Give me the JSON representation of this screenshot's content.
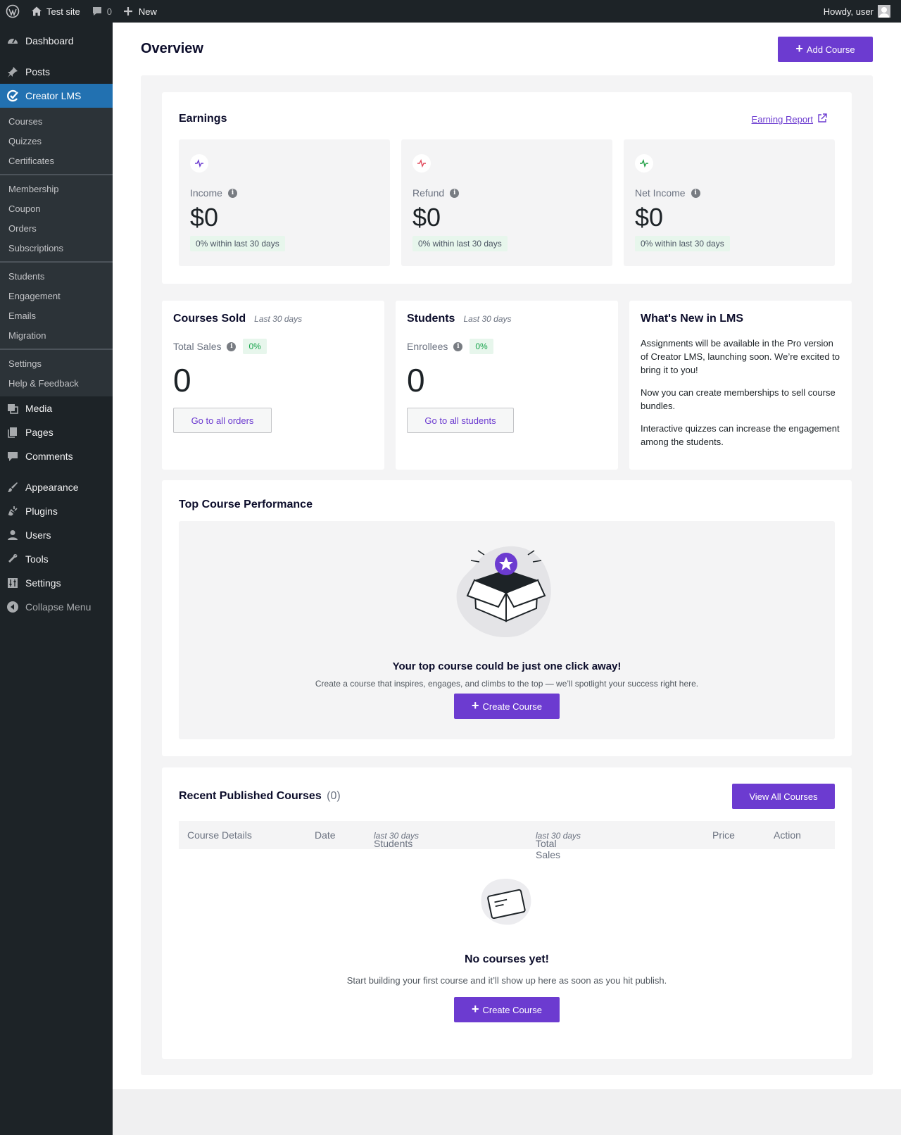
{
  "adminbar": {
    "site_name": "Test site",
    "comments_count": "0",
    "new_label": "New",
    "howdy": "Howdy, user"
  },
  "sidebar": {
    "dashboard": "Dashboard",
    "posts": "Posts",
    "creator_lms": "Creator LMS",
    "submenu": {
      "courses": "Courses",
      "quizzes": "Quizzes",
      "certificates": "Certificates",
      "membership": "Membership",
      "coupon": "Coupon",
      "orders": "Orders",
      "subscriptions": "Subscriptions",
      "students": "Students",
      "engagement": "Engagement",
      "emails": "Emails",
      "migration": "Migration",
      "settings": "Settings",
      "help": "Help & Feedback"
    },
    "media": "Media",
    "pages": "Pages",
    "comments": "Comments",
    "appearance": "Appearance",
    "plugins": "Plugins",
    "users": "Users",
    "tools": "Tools",
    "settings": "Settings",
    "collapse": "Collapse Menu"
  },
  "header": {
    "title": "Overview",
    "add_course": "Add Course"
  },
  "earnings": {
    "title": "Earnings",
    "report_link": "Earning Report",
    "cards": [
      {
        "label": "Income",
        "value": "$0",
        "chip": "0% within last 30 days",
        "color": "#6c3bd0"
      },
      {
        "label": "Refund",
        "value": "$0",
        "chip": "0% within last 30 days",
        "color": "#e0485a"
      },
      {
        "label": "Net Income",
        "value": "$0",
        "chip": "0% within last 30 days",
        "color": "#22a046"
      }
    ]
  },
  "courses_sold": {
    "title": "Courses Sold",
    "period": "Last 30 days",
    "label": "Total Sales",
    "pct": "0%",
    "value": "0",
    "button": "Go to all orders"
  },
  "students": {
    "title": "Students",
    "period": "Last 30 days",
    "label": "Enrollees",
    "pct": "0%",
    "value": "0",
    "button": "Go to all students"
  },
  "whats_new": {
    "title": "What's New in LMS",
    "items": [
      "Assignments will be available in the Pro version of Creator LMS, launching soon. We’re excited to bring it to you!",
      "Now you can create memberships to sell course bundles.",
      "Interactive quizzes can increase the engagement among the students."
    ]
  },
  "top_course": {
    "title": "Top Course Performance",
    "empty_title": "Your top course could be just one click away!",
    "empty_desc": "Create a course that inspires, engages, and climbs to the top — we’ll spotlight your success right here.",
    "button": "Create Course"
  },
  "recent": {
    "title": "Recent Published Courses",
    "count": "(0)",
    "view_all": "View All Courses",
    "columns": {
      "details": "Course Details",
      "date": "Date",
      "students": "Students",
      "students_sub": "last 30 days",
      "sales": "Total Sales",
      "sales_sub": "last 30 days",
      "price": "Price",
      "action": "Action"
    },
    "empty_title": "No courses yet!",
    "empty_desc": "Start building your first course and it’ll show up here as soon as you hit publish.",
    "button": "Create Course"
  },
  "colors": {
    "accent": "#6c3bd0",
    "sidebar_bg": "#1d2327",
    "active_menu": "#2271b1"
  }
}
